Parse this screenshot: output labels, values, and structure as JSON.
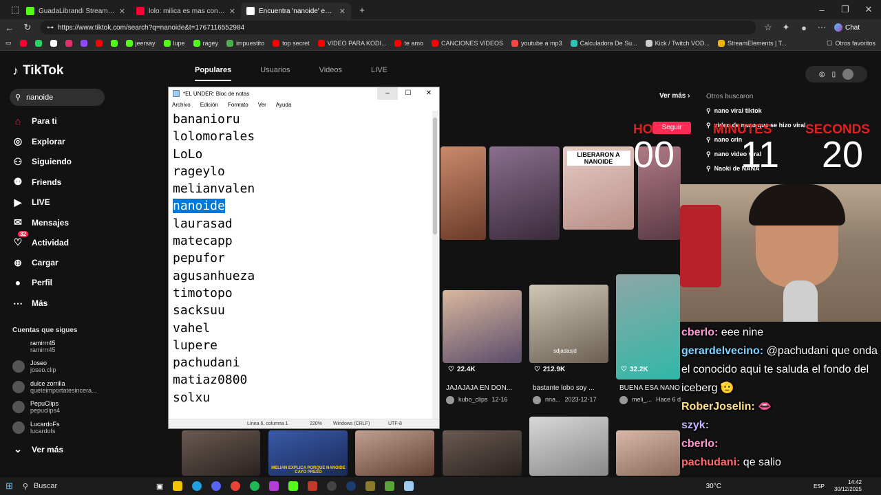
{
  "browser": {
    "tabs": [
      {
        "title": "GuadaLibrandi Stream - Wate",
        "color": "#53fc18",
        "active": false
      },
      {
        "title": "lolo: milica es mas conocida que g",
        "color": "#ff0033",
        "active": false
      },
      {
        "title": "Encuentra 'nanoide' en TikTok | Bú",
        "color": "#ffffff",
        "active": true
      }
    ],
    "url": "https://www.tiktok.com/search?q=nanoide&t=1767116552984",
    "bookmarks": [
      {
        "label": "",
        "color": "#ff0033"
      },
      {
        "label": "",
        "color": "#25d366"
      },
      {
        "label": "",
        "color": "#ffffff"
      },
      {
        "label": "",
        "color": "#e1306c"
      },
      {
        "label": "",
        "color": "#9146ff"
      },
      {
        "label": "",
        "color": "#ff0000"
      },
      {
        "label": "",
        "color": "#53fc18"
      },
      {
        "label": "jeersay",
        "color": "#53fc18"
      },
      {
        "label": "lupe",
        "color": "#53fc18"
      },
      {
        "label": "ragey",
        "color": "#53fc18"
      },
      {
        "label": "impuestito",
        "color": "#4caf50"
      },
      {
        "label": "top secret",
        "color": "#ff0000"
      },
      {
        "label": "VIDEO PARA KODI...",
        "color": "#ff0000"
      },
      {
        "label": "te amo",
        "color": "#ff0000"
      },
      {
        "label": "CANCIONES VIDEOS",
        "color": "#ff0000"
      },
      {
        "label": "youtube a mp3",
        "color": "#ff4444"
      },
      {
        "label": "Calculadora De Su...",
        "color": "#2ec4b6"
      },
      {
        "label": "Kick / Twitch VOD...",
        "color": "#cccccc"
      },
      {
        "label": "StreamElements | T...",
        "color": "#f5b400"
      }
    ],
    "other_bookmarks": "Otros favoritos",
    "chat_label": "Chat"
  },
  "tiktok": {
    "logo": "TikTok",
    "search_value": "nanoide",
    "nav": [
      "Para ti",
      "Explorar",
      "Siguiendo",
      "Friends",
      "LIVE",
      "Mensajes",
      "Actividad",
      "Cargar",
      "Perfil",
      "Más"
    ],
    "nav_icons": [
      "home-icon",
      "compass-icon",
      "following-icon",
      "friends-icon",
      "live-icon",
      "messages-icon",
      "activity-icon",
      "upload-icon",
      "profile-icon",
      "more-icon"
    ],
    "activity_badge": "32",
    "following_header": "Cuentas que sigues",
    "following": [
      {
        "name": "ramirrr45",
        "handle": "ramirrr45"
      },
      {
        "name": "Joseo",
        "handle": "joseo.clip"
      },
      {
        "name": "dulce zorrilla",
        "handle": "queteimportatesincera..."
      },
      {
        "name": "PepuClips",
        "handle": "pepuclips4"
      },
      {
        "name": "LucardoFs",
        "handle": "lucardofs"
      }
    ],
    "see_more": "Ver más",
    "tabs": [
      "Populares",
      "Usuarios",
      "Videos",
      "LIVE"
    ],
    "ver_mas": "Ver más",
    "seguir": "Seguir",
    "others_header": "Otros buscaron",
    "others": [
      "nano viral tiktok",
      "video de nano que se hizo viral",
      "nano crin",
      "nano video viral",
      "Naoki de NANA"
    ],
    "thumb_caption": "LIBERARON A NANOIDE",
    "videos": [
      {
        "likes": "22.4K",
        "title": "JAJAJAJA EN DON...",
        "user": "kubo_clips",
        "date": "12-16"
      },
      {
        "likes": "212.9K",
        "title": "bastante lobo soy ...",
        "user": "nna...",
        "date": "2023-12-17"
      },
      {
        "likes": "32.2K",
        "title": "BUENA ESA NANO",
        "user": "meli_...",
        "date": "Hace 6 d"
      }
    ],
    "thumb_sticker": "sdjadasjd",
    "bottom_caption": "MELIAN EXPLICA PORQUE NANOIDE CAYO PRESO"
  },
  "notepad": {
    "title": "*EL UNDER: Bloc de notas",
    "menu": [
      "Archivo",
      "Edición",
      "Formato",
      "Ver",
      "Ayuda"
    ],
    "lines": [
      "bananioru",
      "lolomorales",
      "LoLo",
      "rageylo",
      "melianvalen",
      "nanoide",
      "laurasad",
      "matecapp",
      "pepufor",
      "agusanhueza",
      "timotopo",
      "sacksuu",
      "vahel",
      "lupere",
      "pachudani",
      "matiaz0800",
      "solxu"
    ],
    "selected_line": 5,
    "status": {
      "position": "Línea 6, columna 1",
      "zoom": "220%",
      "eol": "Windows (CRLF)",
      "encoding": "UTF-8"
    }
  },
  "overlay": {
    "timer_labels": [
      "HO",
      "MINUTES",
      "SECONDS"
    ],
    "hours": "00",
    "minutes": "11",
    "seconds": "20",
    "chat": [
      {
        "user": "cberlo:",
        "text": " eee nine",
        "color": "#ff9ad5"
      },
      {
        "user": "gerardelvecino:",
        "text": " @pachudani que onda el conocido aqui te saluda el fondo del iceberg 🫡",
        "color": "#7fd4ff"
      },
      {
        "user": "RoberJoselin:",
        "text": " 👄",
        "color": "#ffe08a"
      },
      {
        "user": "szyk:",
        "text": "",
        "color": "#c8b8ff"
      },
      {
        "user": "cberlo:",
        "text": "",
        "color": "#ff9ad5"
      },
      {
        "user": "pachudani:",
        "text": " qe salio",
        "color": "#ff6b6b"
      }
    ]
  },
  "taskbar": {
    "search": "Buscar",
    "tray": "30°C",
    "time": "14:42",
    "date": "30/12/2025",
    "lang": "ESP"
  }
}
